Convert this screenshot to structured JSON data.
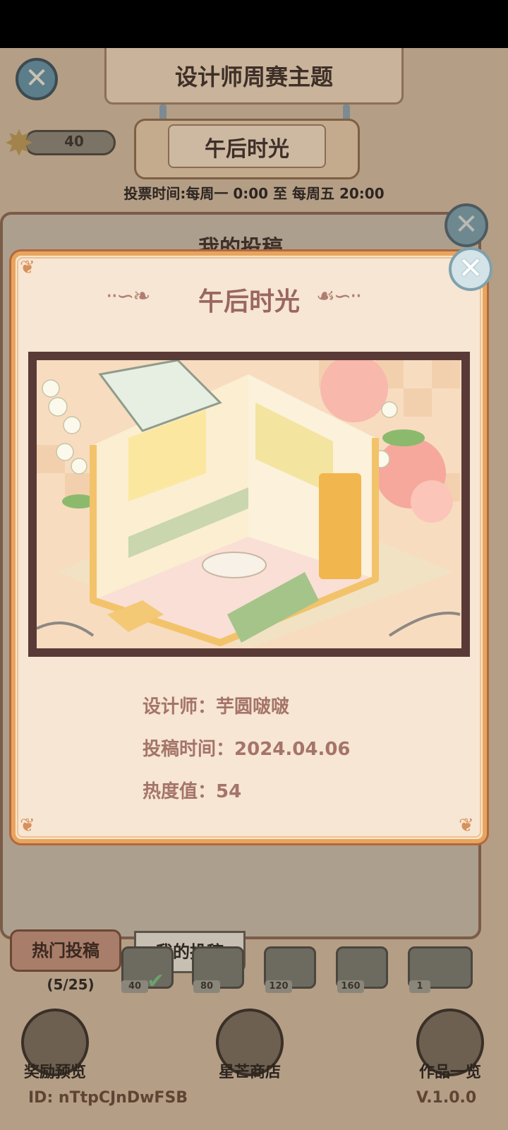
{
  "background": {
    "header_title": "设计师周赛主题",
    "theme_name": "午后时光",
    "star_count": "40",
    "vote_time": "投票时间:每周一  0:00  至  每周五  20:00",
    "panel_title": "我的投稿",
    "tabs": [
      {
        "label": "热门投稿"
      },
      {
        "label": "我的投稿"
      }
    ],
    "progress": "(5/25)",
    "rewards": [
      {
        "value": "40",
        "claimed": true
      },
      {
        "value": "80"
      },
      {
        "value": "120"
      },
      {
        "value": "160"
      },
      {
        "value": "1"
      }
    ],
    "bottom_buttons": [
      {
        "label": "奖励预览",
        "icon": "trophy-icon"
      },
      {
        "label": "星芒商店",
        "icon": "star-icon"
      },
      {
        "label": "作品一览",
        "icon": "book-icon"
      }
    ],
    "player_id": "ID:  nTtpCJnDwFSB",
    "version": "V.1.0.0"
  },
  "popup": {
    "title": "午后时光",
    "image_alt": "isometric room design",
    "designer_label": "设计师：",
    "designer_name": "芋圆啵啵",
    "submit_label": "投稿时间：",
    "submit_date": "2024.04.06",
    "heat_label": "热度值：",
    "heat_value": "54"
  },
  "colors": {
    "popup_bg": "#f6e6d3",
    "popup_border": "#e8a55e",
    "title_color": "#9a6760",
    "frame_color": "#5a3a36"
  }
}
